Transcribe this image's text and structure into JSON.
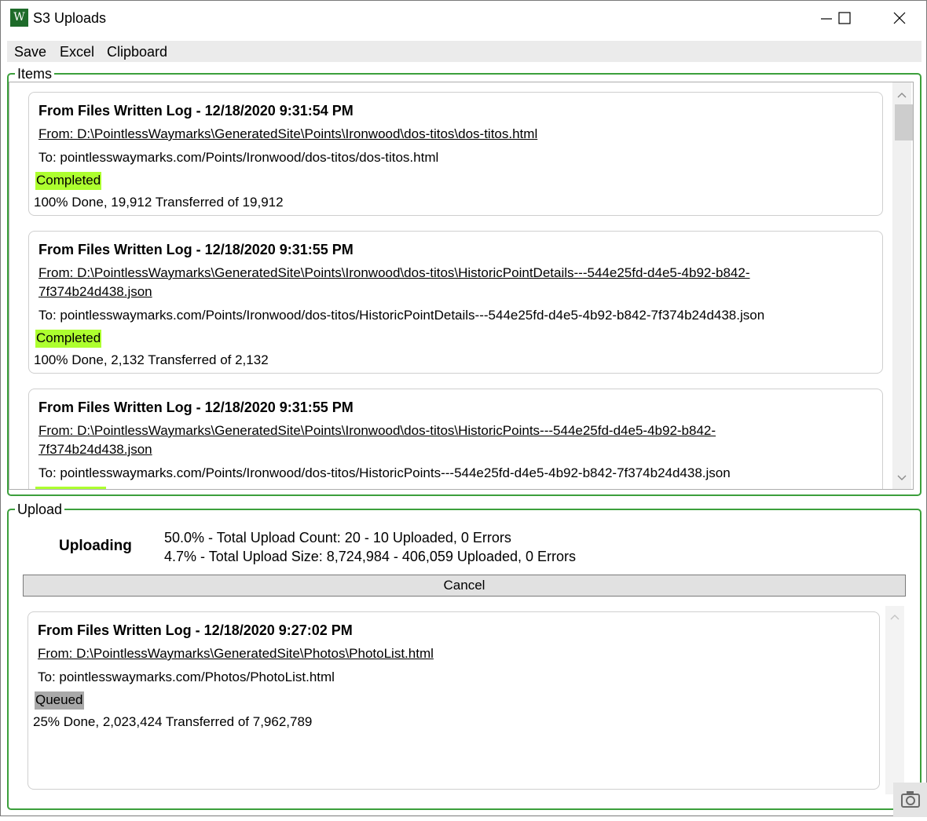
{
  "window": {
    "title": "S3 Uploads",
    "app_icon_glyph": "W",
    "controls": [
      "minimize-icon",
      "maximize-icon",
      "close-icon"
    ]
  },
  "menu": [
    "Save",
    "Excel",
    "Clipboard"
  ],
  "items_group": {
    "label": "Items",
    "cards": [
      {
        "header": "From Files Written Log - 12/18/2020 9:31:54 PM",
        "from": "From: D:\\PointlessWaymarks\\GeneratedSite\\Points\\Ironwood\\dos-titos\\dos-titos.html",
        "to": "To: pointlesswaymarks.com/Points/Ironwood/dos-titos/dos-titos.html",
        "status": "Completed",
        "progress": "100% Done, 19,912 Transferred of 19,912"
      },
      {
        "header": "From Files Written Log - 12/18/2020 9:31:55 PM",
        "from": "From: D:\\PointlessWaymarks\\GeneratedSite\\Points\\Ironwood\\dos-titos\\HistoricPointDetails---544e25fd-d4e5-4b92-b842-7f374b24d438.json",
        "to": "To: pointlesswaymarks.com/Points/Ironwood/dos-titos/HistoricPointDetails---544e25fd-d4e5-4b92-b842-7f374b24d438.json",
        "status": "Completed",
        "progress": "100% Done, 2,132 Transferred of 2,132"
      },
      {
        "header": "From Files Written Log - 12/18/2020 9:31:55 PM",
        "from": "From: D:\\PointlessWaymarks\\GeneratedSite\\Points\\Ironwood\\dos-titos\\HistoricPoints---544e25fd-d4e5-4b92-b842-7f374b24d438.json",
        "to": "To: pointlesswaymarks.com/Points/Ironwood/dos-titos/HistoricPoints---544e25fd-d4e5-4b92-b842-7f374b24d438.json",
        "status": "",
        "progress": ""
      }
    ]
  },
  "upload_group": {
    "label": "Upload",
    "status_label": "Uploading",
    "count_line": "50.0% - Total Upload Count: 20 - 10 Uploaded, 0 Errors",
    "size_line": "4.7% - Total Upload Size: 8,724,984 - 406,059 Uploaded, 0 Errors",
    "cancel_label": "Cancel",
    "current": {
      "header": "From Files Written Log - 12/18/2020 9:27:02 PM",
      "from": "From: D:\\PointlessWaymarks\\GeneratedSite\\Photos\\PhotoList.html",
      "to": "To: pointlesswaymarks.com/Photos/PhotoList.html",
      "status": "Queued",
      "progress": "25% Done, 2,023,424 Transferred of 7,962,789"
    }
  },
  "colors": {
    "group_border": "#3c9f3c",
    "completed": "#adff2f",
    "queued": "#a9a9a9"
  }
}
